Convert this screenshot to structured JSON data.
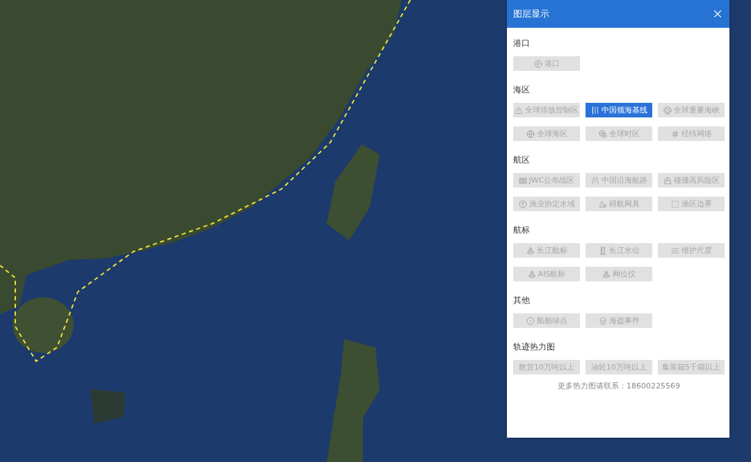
{
  "layer_panel": {
    "title": "图层显示",
    "sections": [
      {
        "title": "港口",
        "buttons": [
          {
            "label": "港口",
            "selected": false
          }
        ]
      },
      {
        "title": "海区",
        "buttons": [
          {
            "label": "全球排放控制区",
            "selected": false
          },
          {
            "label": "中国领海基线",
            "selected": true
          },
          {
            "label": "全球重要海峡",
            "selected": false
          },
          {
            "label": "全球海区",
            "selected": false
          },
          {
            "label": "全球时区",
            "selected": false
          },
          {
            "label": "经纬网络",
            "selected": false
          }
        ]
      },
      {
        "title": "航区",
        "buttons": [
          {
            "label": "JWC公布战区",
            "selected": false
          },
          {
            "label": "中国沿海航路",
            "selected": false
          },
          {
            "label": "碰撞高风险区",
            "selected": false
          },
          {
            "label": "渔业协定水域",
            "selected": false
          },
          {
            "label": "碍航网具",
            "selected": false
          },
          {
            "label": "渔区边界",
            "selected": false
          }
        ]
      },
      {
        "title": "航标",
        "buttons": [
          {
            "label": "长江航标",
            "selected": false
          },
          {
            "label": "长江水位",
            "selected": false
          },
          {
            "label": "维护尺度",
            "selected": false
          },
          {
            "label": "AIS航标",
            "selected": false
          },
          {
            "label": "网位仪",
            "selected": false
          }
        ]
      },
      {
        "title": "其他",
        "buttons": [
          {
            "label": "船舶绿点",
            "selected": false
          },
          {
            "label": "海盗事件",
            "selected": false
          }
        ]
      },
      {
        "title": "轨迹热力图",
        "buttons": [
          {
            "label": "散货10万吨以上",
            "selected": false
          },
          {
            "label": "油轮10万吨以上",
            "selected": false
          },
          {
            "label": "集装箱5千箱以上",
            "selected": false
          }
        ]
      }
    ],
    "footer_note": "更多热力图请联系：18600225569"
  }
}
